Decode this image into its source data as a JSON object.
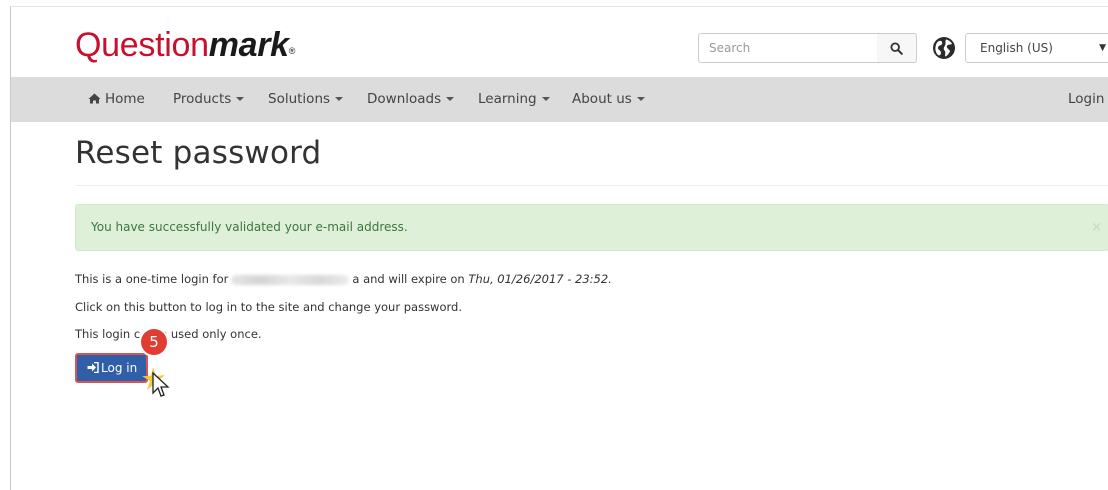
{
  "brand": {
    "part1": "Question",
    "part2": "mark",
    "reg": "®"
  },
  "search": {
    "placeholder": "Search",
    "icon": "search-icon"
  },
  "language": {
    "selected": "English (US)",
    "icon": "globe-icon"
  },
  "nav": {
    "home": "Home",
    "items": [
      "Products",
      "Solutions",
      "Downloads",
      "Learning",
      "About us"
    ],
    "login": "Login"
  },
  "page": {
    "title": "Reset password"
  },
  "alert": {
    "text": "You have successfully validated your e-mail address.",
    "close": "×"
  },
  "messages": {
    "line1_prefix": "This is a one-time login for",
    "line1_middle": "a and will expire on",
    "line1_date": "Thu, 01/26/2017 - 23:52.",
    "line2": "Click on this button to log in to the site and change your password.",
    "line3_prefix": "This login c",
    "line3_suffix": "e used only once."
  },
  "login_button": {
    "label": "Log in"
  },
  "annotation": {
    "step": "5"
  },
  "colors": {
    "brand_red": "#c8102e",
    "button_blue": "#2f5fa8",
    "alert_bg": "#dff0d8",
    "alert_text": "#3c763d"
  }
}
